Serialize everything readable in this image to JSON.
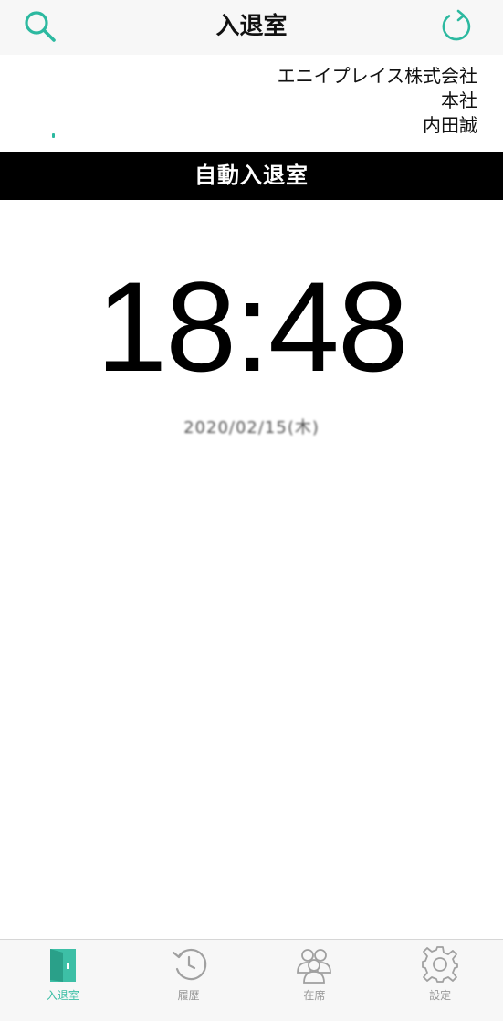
{
  "navbar": {
    "title": "入退室",
    "left_icon": "search-icon",
    "right_icon": "refresh-icon"
  },
  "colors": {
    "accent": "#2cb9a0",
    "banner_bg": "#000000",
    "inactive": "#999999"
  },
  "info": {
    "company": "エニイプレイス株式会社",
    "office": "本社",
    "user": "内田誠"
  },
  "banner": {
    "label": "自動入退室"
  },
  "clock": {
    "time": "18:48"
  },
  "date": {
    "text": "2020/02/15(木)"
  },
  "tabbar": {
    "items": [
      {
        "label": "入退室",
        "icon": "door-icon",
        "active": true
      },
      {
        "label": "履歴",
        "icon": "history-icon",
        "active": false
      },
      {
        "label": "在席",
        "icon": "people-icon",
        "active": false
      },
      {
        "label": "設定",
        "icon": "gear-icon",
        "active": false
      }
    ]
  }
}
